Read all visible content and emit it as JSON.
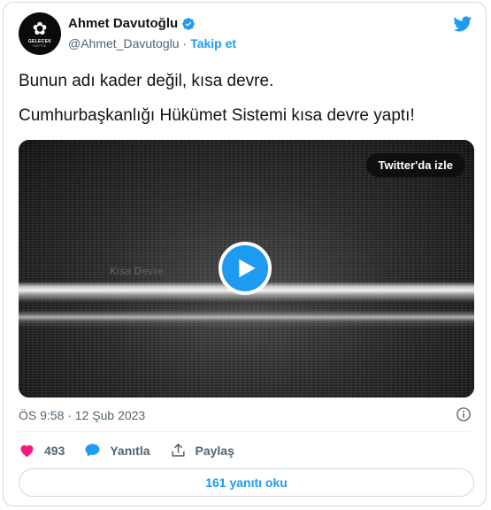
{
  "colors": {
    "accent": "#1d9bf0",
    "like": "#f91880",
    "secondary": "#536471"
  },
  "author": {
    "avatar_text": "GELECEK",
    "avatar_subtext": "PARTİSİ",
    "name": "Ahmet Davutoğlu",
    "verified_icon": "verified-badge-icon",
    "handle": "@Ahmet_Davutoglu",
    "separator": "·",
    "follow_label": "Takip et"
  },
  "brand_icon": "twitter-bird-icon",
  "tweet": {
    "lines": [
      "Bunun adı kader değil, kısa devre.",
      "Cumhurbaşkanlığı Hükümet Sistemi kısa devre yaptı!"
    ]
  },
  "media": {
    "watch_label": "Twitter'da izle",
    "caption_part1": "Kısa",
    "caption_part2": "Devre",
    "play_icon": "play-icon"
  },
  "meta": {
    "timestamp": "ÖS 9:58 · 12 Şub 2023",
    "info_icon": "info-icon"
  },
  "actions": {
    "like_count": "493",
    "reply_label": "Yanıtla",
    "share_label": "Paylaş"
  },
  "replies_button_label": "161 yanıtı oku"
}
